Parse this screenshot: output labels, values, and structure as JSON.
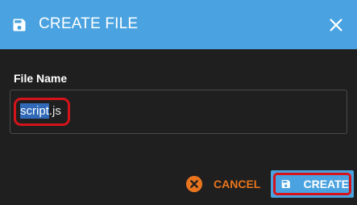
{
  "dialog": {
    "title": "CREATE FILE",
    "title_icon": "save-icon",
    "close_icon": "close-icon"
  },
  "form": {
    "label": "File Name",
    "value_selected": "script",
    "value_rest": ".js"
  },
  "actions": {
    "cancel_label": "CANCEL",
    "cancel_icon": "cancel-circle-icon",
    "create_label": "CREATE",
    "create_icon": "save-icon"
  },
  "colors": {
    "header": "#4aa3e0",
    "background": "#1f1f1f",
    "cancel": "#e8741d",
    "highlight": "#d4141a",
    "selection": "#2f69b8"
  }
}
